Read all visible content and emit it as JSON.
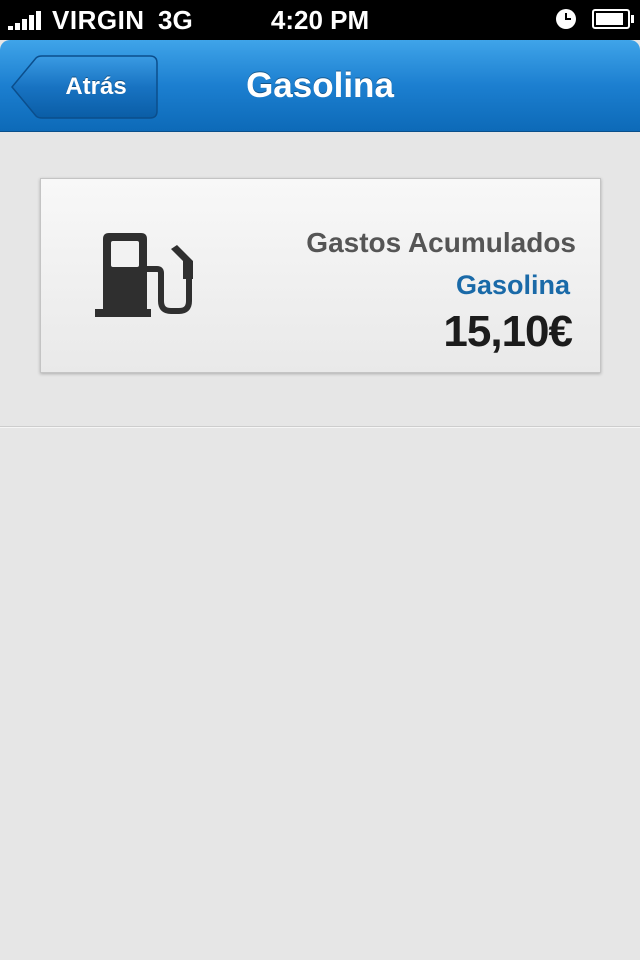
{
  "status_bar": {
    "carrier": "VIRGIN",
    "network": "3G",
    "time": "4:20 PM",
    "signal_bars": 5,
    "battery_level": 0.9
  },
  "nav_bar": {
    "back_label": "Atrás",
    "title": "Gasolina",
    "accent_color": "#1c7fd0"
  },
  "summary_card": {
    "icon": "fuel-pump-icon",
    "label": "Gastos Acumulados",
    "category": "Gasolina",
    "amount": "15,10€",
    "category_color": "#1a6aa8"
  }
}
